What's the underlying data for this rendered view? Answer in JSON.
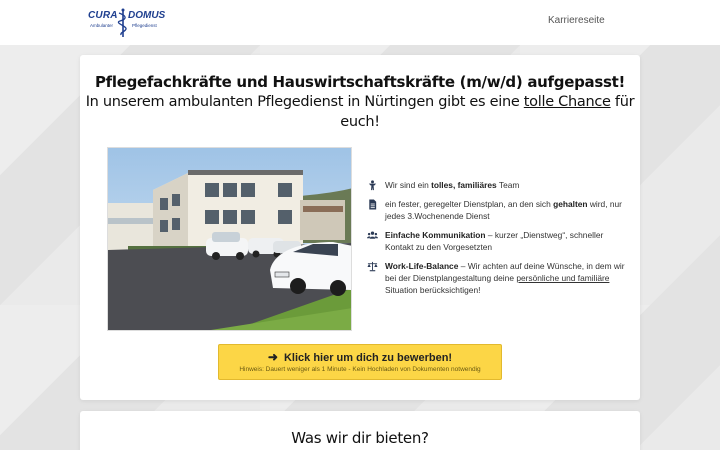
{
  "header": {
    "logo": {
      "left_word": "CURA",
      "right_word": "DOMUS",
      "left_sub": "Ambulanter",
      "right_sub": "Pflegedienst"
    },
    "nav_link": "Karriereseite"
  },
  "hero": {
    "headline_bold": "Pflegefachkräfte und Hauswirtschaftskräfte (m/w/d) aufgepasst!",
    "headline_part1": "In unserem ambulanten Pflegedienst in Nürtingen gibt es eine ",
    "headline_underlined": "tolle Chance",
    "headline_part2": " für euch!"
  },
  "features": [
    {
      "icon": "person-icon",
      "prefix": "Wir sind ein ",
      "bold": "tolles, familiäres",
      "suffix": " Team"
    },
    {
      "icon": "document-icon",
      "prefix": "ein fester, geregelter Dienstplan, an den sich ",
      "bold": "gehalten",
      "suffix": " wird, nur jedes 3.Wochenende Dienst"
    },
    {
      "icon": "group-icon",
      "prefix": "",
      "bold": "Einfache Kommunikation",
      "suffix": " – kurzer „Dienstweg“, schneller Kontakt zu den  Vorgesetzten"
    },
    {
      "icon": "balance-scale-icon",
      "bold": "Work-Life-Balance",
      "middle": " – Wir achten auf deine Wünsche, in dem wir bei der Dienstplangestaltung deine ",
      "underlined": "persönliche und familiäre",
      "suffix": " Situation berücksichtigen!"
    }
  ],
  "cta": {
    "label": "Klick hier um dich zu bewerben!",
    "hint": "Hinweis: Dauert weniger als 1 Minute - Kein Hochladen von Dokumenten notwendig",
    "icon": "arrow-right-icon"
  },
  "section2": {
    "title": "Was wir dir bieten?"
  },
  "colors": {
    "brand": "#1f3f8f",
    "cta_background": "#fcd646",
    "page_background": "#e6e6e6"
  }
}
